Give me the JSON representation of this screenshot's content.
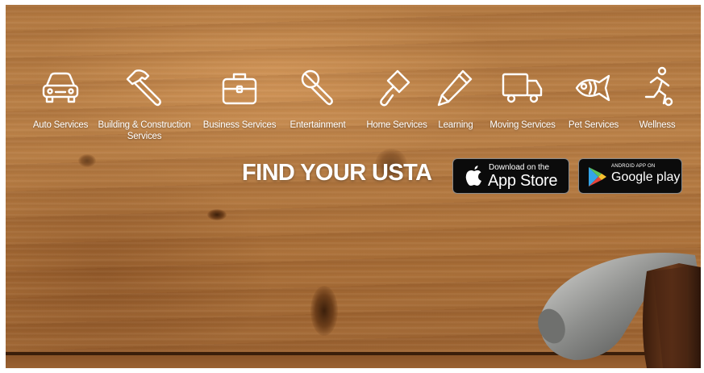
{
  "services": [
    {
      "label": "Auto Services",
      "icon": "car-icon"
    },
    {
      "label": "Building  & Construction Services",
      "icon": "hammer-icon"
    },
    {
      "label": "Business Services",
      "icon": "briefcase-icon"
    },
    {
      "label": "Entertainment",
      "icon": "microphone-icon"
    },
    {
      "label": "Home Services",
      "icon": "paint-roller-icon"
    },
    {
      "label": "Learning",
      "icon": "pencil-icon"
    },
    {
      "label": "Moving Services",
      "icon": "truck-icon"
    },
    {
      "label": "Pet Services",
      "icon": "fish-icon"
    },
    {
      "label": "Wellness",
      "icon": "runner-icon"
    }
  ],
  "tagline": "FIND YOUR USTA",
  "app_store": {
    "small": "Download on the",
    "big": "App Store",
    "icon": "apple-icon"
  },
  "google_play": {
    "small": "ANDROID APP ON",
    "big": "Google play",
    "icon": "google-play-icon"
  },
  "colors": {
    "wood": "#b1773f",
    "text": "#ffffff",
    "button_bg": "#0b0b0b"
  }
}
